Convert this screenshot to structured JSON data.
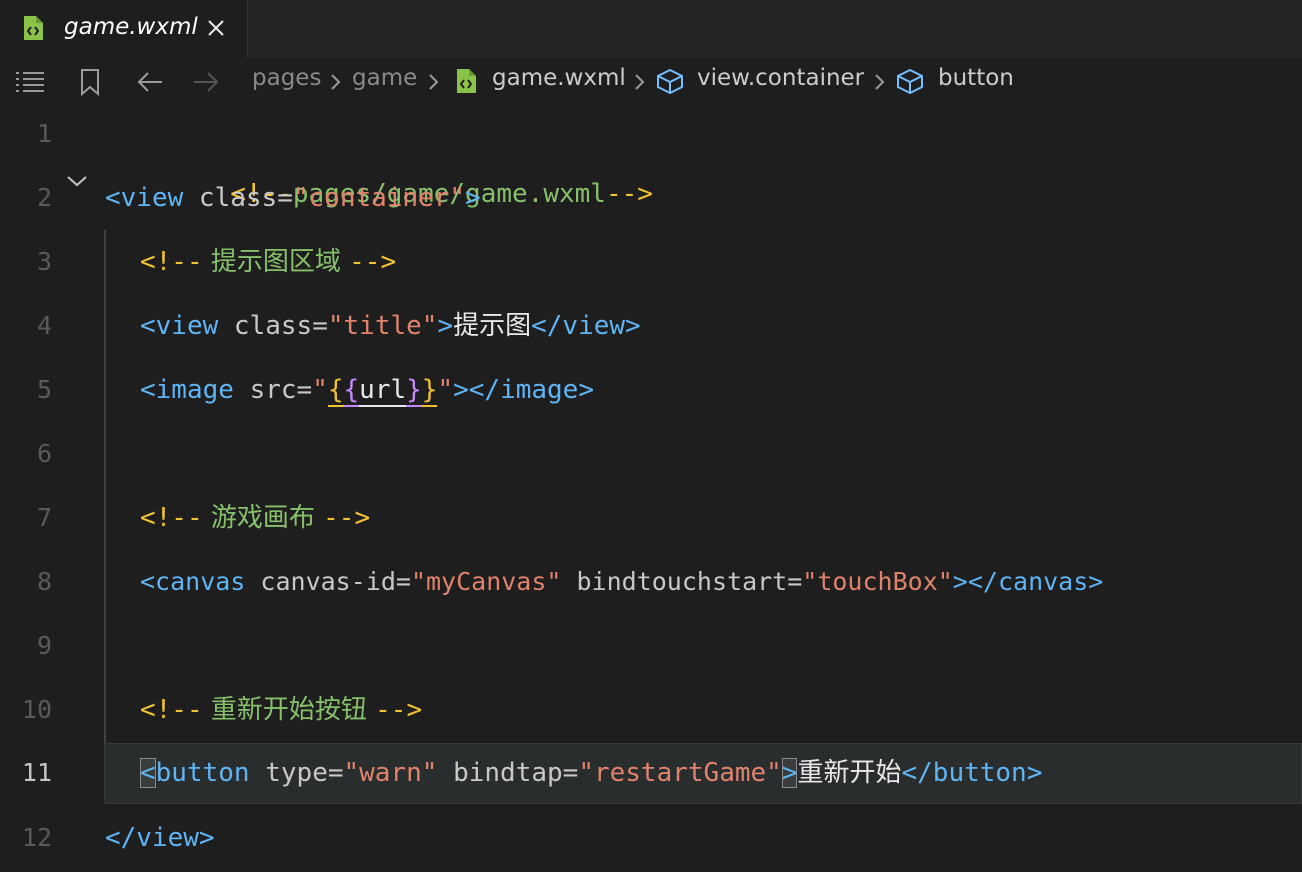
{
  "tab": {
    "label": "game.wxml"
  },
  "breadcrumb": {
    "items": [
      "pages",
      "game",
      "game.wxml",
      "view.container",
      "button"
    ]
  },
  "lines": {
    "1": {
      "num": "1",
      "comment": "<!--pages/game/game.wxml-->"
    },
    "2": {
      "num": "2",
      "open": "<view",
      "attr": " class=",
      "str": "\"container\"",
      "close": ">"
    },
    "3": {
      "num": "3",
      "cd_open": "<!--",
      "comment": " 提示图区域 ",
      "cd_close": "-->"
    },
    "4": {
      "num": "4",
      "open": "<view",
      "attr": " class=",
      "str": "\"title\"",
      "close": ">",
      "text": "提示图",
      "end": "</view>"
    },
    "5": {
      "num": "5",
      "open": "<image",
      "attr": " src=",
      "q1": "\"",
      "b1": "{",
      "b2": "{",
      "var": "url",
      "b3": "}",
      "b4": "}",
      "q2": "\"",
      "close": ">",
      "end": "</image>"
    },
    "6": {
      "num": "6"
    },
    "7": {
      "num": "7",
      "cd_open": "<!--",
      "comment": " 游戏画布 ",
      "cd_close": "-->"
    },
    "8": {
      "num": "8",
      "open": "<canvas",
      "attr1": " canvas-id=",
      "str1": "\"myCanvas\"",
      "attr2": " bindtouchstart=",
      "str2": "\"touchBox\"",
      "close": ">",
      "end": "</canvas>"
    },
    "9": {
      "num": "9"
    },
    "10": {
      "num": "10",
      "cd_open": "<!--",
      "comment": " 重新开始按钮 ",
      "cd_close": "-->"
    },
    "11": {
      "num": "11",
      "lt": "<",
      "open": "button",
      "attr1": " type=",
      "str1": "\"warn\"",
      "attr2": " bindtap=",
      "str2": "\"restartGame\"",
      "close": ">",
      "text": "重新开始",
      "end": "</button>"
    },
    "12": {
      "num": "12",
      "end": "</view>"
    }
  },
  "colors": {
    "tag": "#5fb4f4",
    "attribute": "#c8c8c8",
    "string": "#e0826c",
    "comment": "#86c06a",
    "comment_delimiter": "#f1c232",
    "file_icon": "#8bc34a"
  },
  "icons": {
    "tab_file": "wxml-file-icon",
    "tab_close": "close-icon",
    "outline": "list-icon",
    "bookmark": "bookmark-icon",
    "back": "arrow-left-icon",
    "forward": "arrow-right-icon",
    "element": "cube-icon",
    "fold": "chevron-down-icon"
  }
}
